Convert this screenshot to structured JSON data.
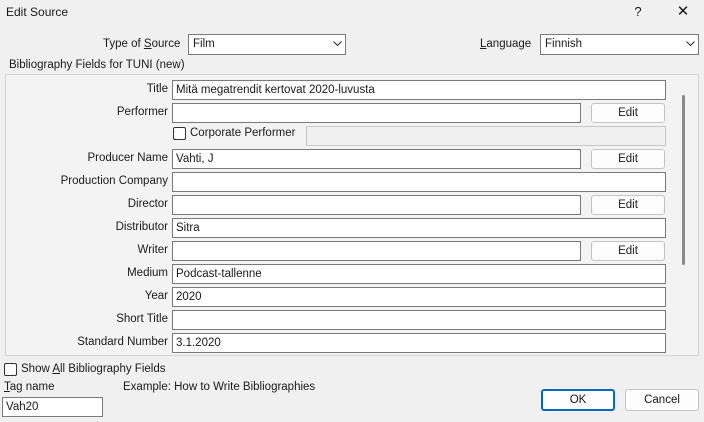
{
  "window": {
    "title": "Edit Source",
    "help": "?",
    "close": "✕"
  },
  "type_of_source": {
    "label_pre": "Type of ",
    "label_u": "S",
    "label_post": "ource",
    "value": "Film"
  },
  "language": {
    "label_u": "L",
    "label_post": "anguage",
    "value": "Finnish"
  },
  "group_label": "Bibliography Fields for TUNI (new)",
  "fields": {
    "title": {
      "label": "Title",
      "value": "Mitä megatrendit kertovat 2020-luvusta"
    },
    "performer": {
      "label": "Performer",
      "value": "",
      "edit": "Edit"
    },
    "corporate_performer": {
      "label": "Corporate Performer",
      "value": ""
    },
    "producer_name": {
      "label": "Producer Name",
      "value": "Vahti, J",
      "edit": "Edit"
    },
    "production_company": {
      "label": "Production Company",
      "value": ""
    },
    "director": {
      "label": "Director",
      "value": "",
      "edit": "Edit"
    },
    "distributor": {
      "label": "Distributor",
      "value": "Sitra"
    },
    "writer": {
      "label": "Writer",
      "value": "",
      "edit": "Edit"
    },
    "medium": {
      "label": "Medium",
      "value": "Podcast-tallenne"
    },
    "year": {
      "label": "Year",
      "value": "2020"
    },
    "short_title": {
      "label": "Short Title",
      "value": ""
    },
    "standard_number": {
      "label": "Standard Number",
      "value": "3.1.2020"
    }
  },
  "show_all": {
    "label_pre": "Show ",
    "label_u": "A",
    "label_post": "ll Bibliography Fields"
  },
  "tag_name": {
    "label_u": "T",
    "label_post": "ag name",
    "value": "Vah20"
  },
  "example": "Example: How to Write Bibliographies",
  "buttons": {
    "ok": "OK",
    "cancel": "Cancel"
  }
}
